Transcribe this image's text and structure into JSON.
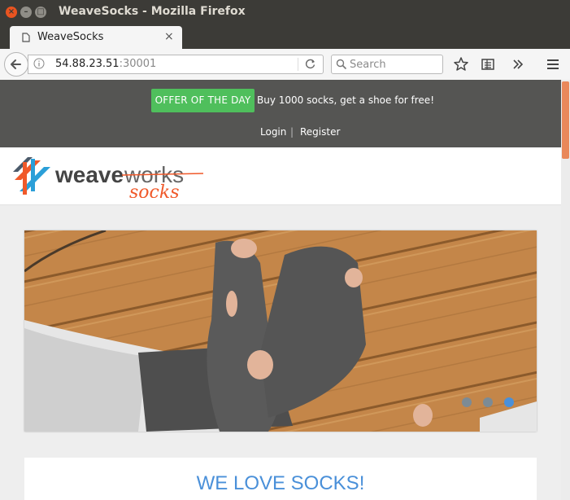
{
  "window": {
    "title": "WeaveSocks - Mozilla Firefox"
  },
  "tab": {
    "label": "WeaveSocks",
    "close_glyph": "×",
    "new_tab_glyph": "+"
  },
  "navbar": {
    "url_host": "54.88.23.51",
    "url_port": ":30001",
    "search_placeholder": "Search"
  },
  "promo": {
    "offer_label": "OFFER OF THE DAY",
    "offer_text": "Buy 1000 socks, get a shoe for free!",
    "login_label": "Login",
    "separator": "|",
    "register_label": "Register"
  },
  "logo": {
    "brand_primary": "weave",
    "brand_secondary": "works",
    "brand_tag": "socks"
  },
  "carousel": {
    "slide_count": 3,
    "active_index": 2
  },
  "hero": {
    "heading": "WE LOVE SOCKS!"
  },
  "colors": {
    "offer_green": "#4fbf5c",
    "accent_blue": "#4a90d9",
    "weave_orange": "#f0592a",
    "topbar_gray": "#555553",
    "scroll_thumb": "#e9885a"
  },
  "icons": [
    "close-icon",
    "minimize-icon",
    "maximize-icon",
    "page-icon",
    "back-arrow-icon",
    "info-icon",
    "reload-icon",
    "search-icon",
    "star-icon",
    "reading-list-icon",
    "overflow-chevron-icon",
    "hamburger-menu-icon",
    "weaveworks-logo-icon"
  ]
}
